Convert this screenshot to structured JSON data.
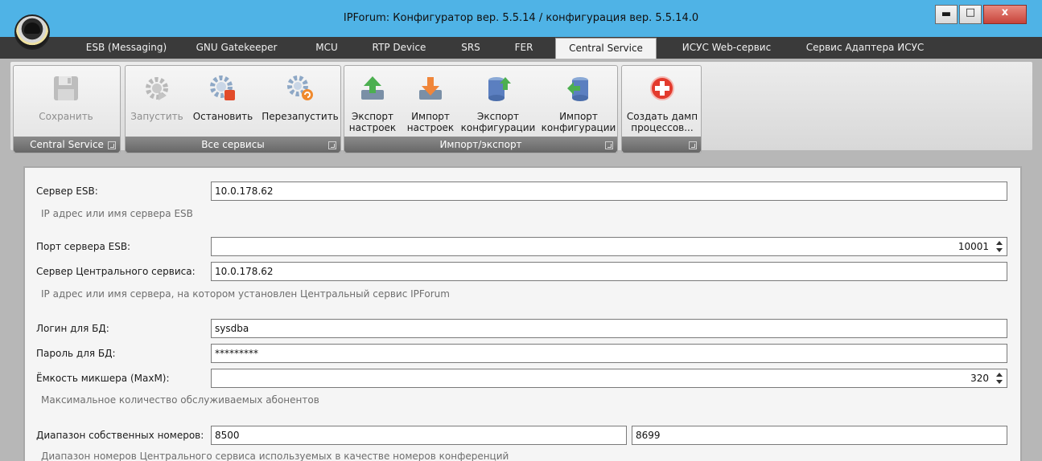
{
  "window": {
    "title": "IPForum: Конфигуратор вер. 5.5.14 / конфигурация вер. 5.5.14.0",
    "min_symbol": "▬",
    "max_symbol": "□",
    "close_symbol": "x"
  },
  "tabs": [
    {
      "label": "ESB (Messaging)"
    },
    {
      "label": "GNU Gatekeeper"
    },
    {
      "label": "MCU"
    },
    {
      "label": "RTP Device"
    },
    {
      "label": "SRS"
    },
    {
      "label": "FER"
    },
    {
      "label": "Central Service",
      "active": true
    },
    {
      "label": "ИСУС Web-сервис"
    },
    {
      "label": "Сервис Адаптера ИСУС"
    }
  ],
  "ribbon": {
    "groups": [
      {
        "label": "Central Service",
        "buttons": [
          {
            "label": "Сохранить",
            "icon": "floppy-disk-icon",
            "enabled": false
          }
        ]
      },
      {
        "label": "Все сервисы",
        "buttons": [
          {
            "label": "Запустить",
            "icon": "gear-start-icon",
            "enabled": false
          },
          {
            "label": "Остановить",
            "icon": "gear-stop-icon",
            "enabled": true
          },
          {
            "label": "Перезапустить",
            "icon": "gear-restart-icon",
            "enabled": true
          }
        ]
      },
      {
        "label": "Импорт/экспорт",
        "buttons": [
          {
            "label": "Экспорт\nнастроек",
            "line1": "Экспорт",
            "line2": "настроек",
            "icon": "export-settings-icon",
            "enabled": true
          },
          {
            "label": "Импорт\nнастроек",
            "line1": "Импорт",
            "line2": "настроек",
            "icon": "import-settings-icon",
            "enabled": true
          },
          {
            "label": "Экспорт\nконфигурации",
            "line1": "Экспорт",
            "line2": "конфигурации",
            "icon": "export-config-icon",
            "enabled": true
          },
          {
            "label": "Импорт\nконфигурации",
            "line1": "Импорт",
            "line2": "конфигурации",
            "icon": "import-config-icon",
            "enabled": true
          }
        ]
      },
      {
        "label": "",
        "buttons": [
          {
            "label": "Создать дамп\nпроцессов...",
            "line1": "Создать дамп",
            "line2": "процессов...",
            "icon": "create-dump-icon",
            "enabled": true
          }
        ]
      }
    ]
  },
  "form": {
    "esb_server": {
      "label": "Сервер ESB:",
      "value": "10.0.178.62",
      "hint": "IP адрес или имя сервера ESB"
    },
    "esb_port": {
      "label": "Порт сервера ESB:",
      "value": "10001"
    },
    "central_server": {
      "label": "Сервер Центрального сервиса:",
      "value": "10.0.178.62",
      "hint": "IP адрес или имя сервера, на котором установлен Центральный сервис IPForum"
    },
    "db_login": {
      "label": "Логин для БД:",
      "value": "sysdba"
    },
    "db_password": {
      "label": "Пароль для БД:",
      "value": "*********"
    },
    "mixer_capacity": {
      "label": "Ёмкость микшера (MaxM):",
      "value": "320",
      "hint": "Максимальное количество обслуживаемых абонентов"
    },
    "own_numbers": {
      "label": "Диапазон собственных номеров:",
      "from": "8500",
      "to": "8699",
      "hint": "Диапазон номеров Центрального сервиса используемых в качестве номеров конференций"
    }
  }
}
